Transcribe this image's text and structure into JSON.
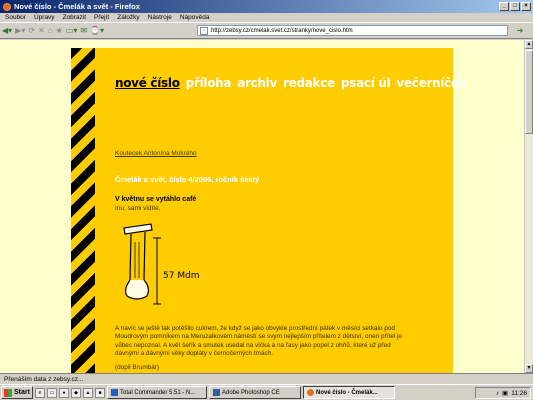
{
  "window": {
    "title": "Nové číslo - Čmelák a svět - Firefox"
  },
  "menu": [
    "Soubor",
    "Úpravy",
    "Zobrazit",
    "Přejít",
    "Záložky",
    "Nástroje",
    "Nápověda"
  ],
  "address": {
    "url": "http://zebsy.cz/cmelak.svet.cz/stranky/nove_cislo.htm"
  },
  "nav": {
    "items": [
      {
        "label": "nové číslo",
        "active": true
      },
      {
        "label": "příloha",
        "active": false
      },
      {
        "label": "archiv",
        "active": false
      },
      {
        "label": "redakce",
        "active": false
      },
      {
        "label": "psací úl",
        "active": false
      },
      {
        "label": "večerníček",
        "active": false
      }
    ]
  },
  "article": {
    "koutecek": "Koutecek Antonína Mokrého",
    "issue": "Čmelák a svět, číslo 4/2005, ročník šestý",
    "title": "V květnu se vytáhlo café",
    "subtitle": "Inu, sami vidíte.",
    "sketch_label": "57 Mdm",
    "paragraph": "A navíc se ještě tak potěšilo cukrem, že když se jako obvykle prostřední pátek v měsíci setkalo pod Moudrovým pomníkem na Meruzalkovém náměstí se svým nejlepším přítelem z dětství, onen přítel je vůbec nepoznal. A květ šeřík a smutek usedal na víčka a na řasy jako popel z ohňů, které už před dávnými a dávnými věky dopláty v černočerných tmách.",
    "signature": "(dopil Brumbár)"
  },
  "status": {
    "text": "Přenáším data z zebsy.cz..."
  },
  "taskbar": {
    "start": "Start",
    "tasks": [
      {
        "label": "Total Commander 5.51 - N...",
        "active": false
      },
      {
        "label": "Adobe Photoshop CE",
        "active": false
      },
      {
        "label": "Nové číslo - Čmelák...",
        "active": true
      }
    ],
    "clock": "11:26"
  },
  "colors": {
    "page_bg": "#ffcc00",
    "outer_bg": "#ffffcc",
    "nav_active": "#000000",
    "nav_inactive": "#ffffff"
  }
}
